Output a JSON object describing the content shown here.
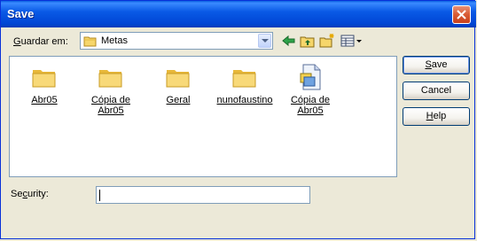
{
  "window": {
    "title": "Save"
  },
  "lookin": {
    "label_prefix": "G",
    "label_rest": "uardar em:",
    "current": "Metas"
  },
  "toolbar": {
    "icons": [
      "back-arrow-icon",
      "up-folder-icon",
      "new-folder-icon",
      "view-menu-icon"
    ]
  },
  "files": [
    {
      "label": "Abr05",
      "type": "folder"
    },
    {
      "label": "Cópia de Abr05",
      "type": "folder"
    },
    {
      "label": "Geral",
      "type": "folder"
    },
    {
      "label": "nunofaustino",
      "type": "folder"
    },
    {
      "label": "Cópia de Abr05",
      "type": "document"
    }
  ],
  "buttons": {
    "save_pre": "",
    "save_u": "S",
    "save_post": "ave",
    "cancel": "Cancel",
    "help_pre": "",
    "help_u": "H",
    "help_post": "elp"
  },
  "security": {
    "label_pre": "Se",
    "label_u": "c",
    "label_post": "urity:",
    "value": ""
  },
  "colors": {
    "titlebar": "#0054e3",
    "close": "#d95b34",
    "dialog_bg": "#ece9d8",
    "folder": "#f6d66b"
  }
}
